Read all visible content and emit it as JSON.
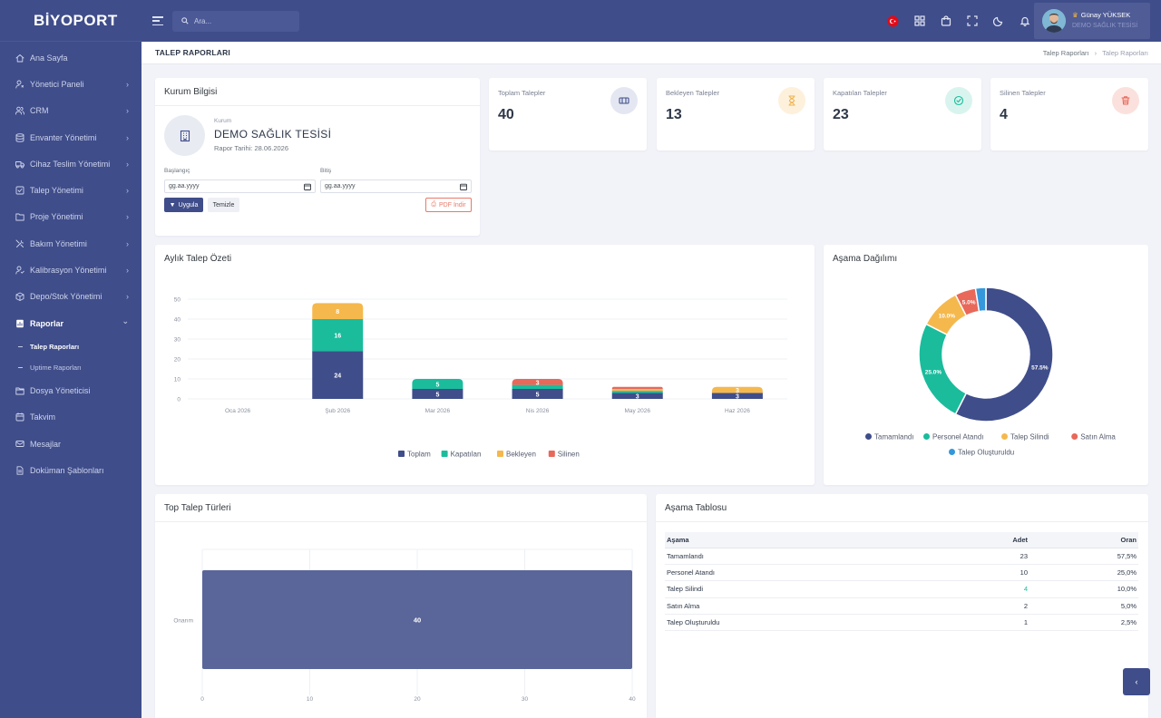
{
  "brand": "BİYOPORT",
  "sidebar": {
    "items": [
      {
        "label": "Ana Sayfa",
        "icon": "home-icon",
        "chevron": false
      },
      {
        "label": "Yönetici Paneli",
        "icon": "user-gear-icon",
        "chevron": true
      },
      {
        "label": "CRM",
        "icon": "users-icon",
        "chevron": true
      },
      {
        "label": "Envanter Yönetimi",
        "icon": "database-icon",
        "chevron": true
      },
      {
        "label": "Cihaz Teslim Yönetimi",
        "icon": "truck-icon",
        "chevron": true
      },
      {
        "label": "Talep Yönetimi",
        "icon": "checkbox-icon",
        "chevron": true
      },
      {
        "label": "Proje Yönetimi",
        "icon": "folder-icon",
        "chevron": true
      },
      {
        "label": "Bakım Yönetimi",
        "icon": "tools-icon",
        "chevron": true
      },
      {
        "label": "Kalibrasyon Yönetimi",
        "icon": "user-check-icon",
        "chevron": true
      },
      {
        "label": "Depo/Stok Yönetimi",
        "icon": "box-icon",
        "chevron": true
      },
      {
        "label": "Raporlar",
        "icon": "report-icon",
        "chevron": true,
        "active": true
      }
    ],
    "subitems": [
      {
        "label": "Talep Raporları",
        "active": true
      },
      {
        "label": "Uptime Raporları",
        "active": false
      }
    ],
    "items_after": [
      {
        "label": "Dosya Yöneticisi",
        "icon": "file-folder-icon"
      },
      {
        "label": "Takvim",
        "icon": "calendar-icon"
      },
      {
        "label": "Mesajlar",
        "icon": "message-icon"
      },
      {
        "label": "Doküman Şablonları",
        "icon": "document-icon"
      }
    ]
  },
  "header": {
    "search_placeholder": "Ara...",
    "user_name": "Günay YÜKSEK",
    "user_org": "DEMO SAĞLIK TESİSİ"
  },
  "page": {
    "title": "TALEP RAPORLARI",
    "breadcrumb": [
      "Talep Raporları",
      "Talep Raporları"
    ]
  },
  "kurum": {
    "title": "Kurum Bilgisi",
    "label": "Kurum",
    "name": "DEMO SAĞLIK TESİSİ",
    "date": "Rapor Tarihi: 28.06.2026",
    "start_label": "Başlangıç",
    "end_label": "Bitiş",
    "start_value": "gg.aa.yyyy",
    "end_value": "gg.aa.yyyy",
    "apply": "Uygula",
    "clear": "Temizle",
    "pdf": "PDF İndir"
  },
  "stats": [
    {
      "label": "Toplam Talepler",
      "value": "40",
      "icon": "ticket-icon",
      "color": "#3f4d8a",
      "bg": "#e4e7f1"
    },
    {
      "label": "Bekleyen Talepler",
      "value": "13",
      "icon": "hourglass-icon",
      "color": "#f0b24a",
      "bg": "#fdf1dc"
    },
    {
      "label": "Kapatılan Talepler",
      "value": "23",
      "icon": "check-circle-icon",
      "color": "#1abc9c",
      "bg": "#d9f4ee"
    },
    {
      "label": "Silinen Talepler",
      "value": "4",
      "icon": "trash-icon",
      "color": "#e8685a",
      "bg": "#fbe1dd"
    }
  ],
  "monthly": {
    "title": "Aylık Talep Özeti"
  },
  "stage_dist": {
    "title": "Aşama Dağılımı"
  },
  "top_types": {
    "title": "Top Talep Türleri"
  },
  "stage_table": {
    "title": "Aşama Tablosu",
    "headers": [
      "Aşama",
      "Adet",
      "Oran"
    ],
    "rows": [
      [
        "Tamamlandı",
        "23",
        "57,5%"
      ],
      [
        "Personel Atandı",
        "10",
        "25,0%"
      ],
      [
        "Talep Silindi",
        "4",
        "10,0%"
      ],
      [
        "Satın Alma",
        "2",
        "5,0%"
      ],
      [
        "Talep Oluşturuldu",
        "1",
        "2,5%"
      ]
    ]
  },
  "chart_data": [
    {
      "type": "bar",
      "stacked": true,
      "title": "Aylık Talep Özeti",
      "categories": [
        "Oca 2026",
        "Şub 2026",
        "Mar 2026",
        "Nis 2026",
        "May 2026",
        "Haz 2026"
      ],
      "series": [
        {
          "name": "Toplam",
          "color": "#3f4d8a",
          "values": [
            0,
            24,
            5,
            5,
            3,
            3
          ]
        },
        {
          "name": "Kapatılan",
          "color": "#1abc9c",
          "values": [
            0,
            16,
            5,
            2,
            1,
            0
          ]
        },
        {
          "name": "Bekleyen",
          "color": "#f5b84d",
          "values": [
            0,
            8,
            0,
            0,
            1,
            3
          ]
        },
        {
          "name": "Silinen",
          "color": "#e8685a",
          "values": [
            0,
            0,
            0,
            3,
            1,
            0
          ]
        }
      ],
      "data_labels": [
        [
          null,
          "24",
          "5",
          "5",
          "3",
          "3"
        ],
        [
          null,
          "16",
          "5",
          null,
          null,
          null
        ],
        [
          null,
          "8",
          null,
          null,
          null,
          "3"
        ],
        [
          null,
          null,
          null,
          "3",
          null,
          null
        ]
      ],
      "yticks": [
        0,
        10,
        20,
        30,
        40,
        50
      ],
      "ylim": [
        0,
        50
      ],
      "grid": true,
      "legend": "bottom"
    },
    {
      "type": "pie",
      "donut": true,
      "title": "Aşama Dağılımı",
      "labels": [
        "Tamamlandı",
        "Personel Atandı",
        "Talep Silindi",
        "Satın Alma",
        "Talep Oluşturuldu"
      ],
      "values": [
        57.5,
        25.0,
        10.0,
        5.0,
        2.5
      ],
      "value_labels": [
        "57.5%",
        "25.0%",
        "10.0%",
        "5.0%",
        null
      ],
      "colors": [
        "#3f4d8a",
        "#1abc9c",
        "#f5b84d",
        "#e8685a",
        "#3498db"
      ],
      "legend": "bottom"
    },
    {
      "type": "bar",
      "orientation": "horizontal",
      "title": "Top Talep Türleri",
      "categories": [
        "Onarım"
      ],
      "values": [
        40
      ],
      "color": "#5a6699",
      "xticks": [
        0,
        10,
        20,
        30,
        40
      ],
      "xlim": [
        0,
        40
      ],
      "grid": true
    }
  ]
}
